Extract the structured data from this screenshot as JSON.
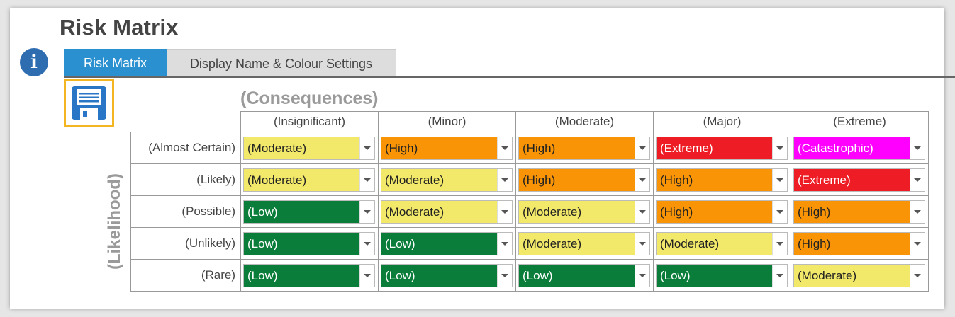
{
  "page": {
    "title": "Risk Matrix"
  },
  "tabs": [
    {
      "label": "Risk Matrix",
      "active": true
    },
    {
      "label": "Display Name & Colour Settings",
      "active": false
    }
  ],
  "icons": {
    "info": "info-icon",
    "save": "floppy-disk-icon"
  },
  "matrix": {
    "consequences_label": "(Consequences)",
    "likelihood_label": "(Likelihood)",
    "columns": [
      "(Insignificant)",
      "(Minor)",
      "(Moderate)",
      "(Major)",
      "(Extreme)"
    ],
    "rows": [
      {
        "label": "(Almost Certain)",
        "cells": [
          "(Moderate)",
          "(High)",
          "(High)",
          "(Extreme)",
          "(Catastrophic)"
        ]
      },
      {
        "label": "(Likely)",
        "cells": [
          "(Moderate)",
          "(Moderate)",
          "(High)",
          "(High)",
          "(Extreme)"
        ]
      },
      {
        "label": "(Possible)",
        "cells": [
          "(Low)",
          "(Moderate)",
          "(Moderate)",
          "(High)",
          "(High)"
        ]
      },
      {
        "label": "(Unlikely)",
        "cells": [
          "(Low)",
          "(Low)",
          "(Moderate)",
          "(Moderate)",
          "(High)"
        ]
      },
      {
        "label": "(Rare)",
        "cells": [
          "(Low)",
          "(Low)",
          "(Low)",
          "(Low)",
          "(Moderate)"
        ]
      }
    ]
  },
  "colors": {
    "(Low)": {
      "bg": "#0b7d3a",
      "fg": "#ffffff"
    },
    "(Moderate)": {
      "bg": "#f2e86a",
      "fg": "#222222"
    },
    "(High)": {
      "bg": "#f89406",
      "fg": "#222222"
    },
    "(Extreme)": {
      "bg": "#ee1c25",
      "fg": "#ffffff"
    },
    "(Catastrophic)": {
      "bg": "#ff00ff",
      "fg": "#ffffff"
    }
  }
}
